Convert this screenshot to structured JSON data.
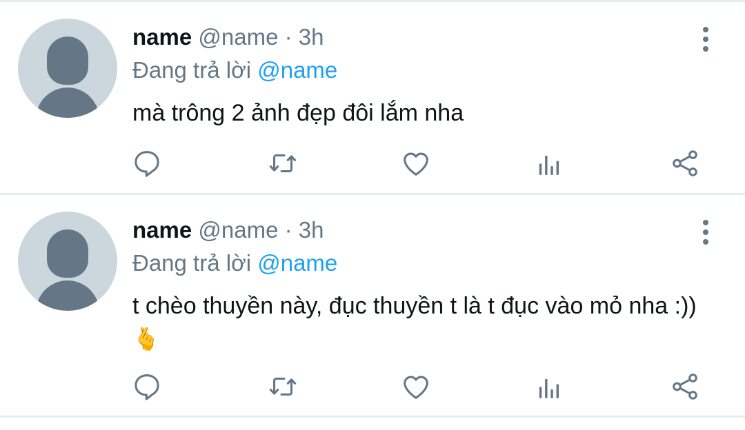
{
  "tweets": [
    {
      "name": "name",
      "handle": "@name",
      "separator": "·",
      "time": "3h",
      "reply_prefix": "Đang trả lời",
      "reply_to": "@name",
      "text": "mà trông 2 ảnh đẹp đôi lắm nha",
      "emoji": ""
    },
    {
      "name": "name",
      "handle": "@name",
      "separator": "·",
      "time": "3h",
      "reply_prefix": "Đang trả lời",
      "reply_to": "@name",
      "text": "t chèo thuyền này, đục thuyền t là t đục vào mỏ nha :))",
      "emoji": "🫰"
    }
  ],
  "actions": [
    "reply-icon",
    "retweet-icon",
    "like-icon",
    "analytics-icon",
    "share-icon"
  ],
  "colors": {
    "text": "#0f1419",
    "secondary": "#657786",
    "accent": "#1da1f2",
    "avatar_bg": "#ccd6dd",
    "divider": "#e6ecf0"
  }
}
